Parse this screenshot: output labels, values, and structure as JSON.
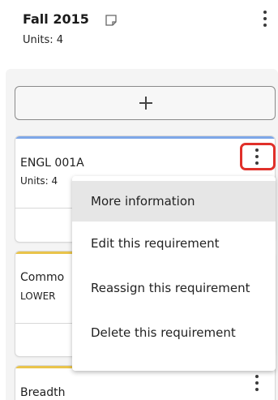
{
  "term": {
    "title": "Fall 2015",
    "units_text": "Units:  4"
  },
  "cards": [
    {
      "title": "ENGL 001A",
      "sub": "Units: 4",
      "accent": "#7ea7e8"
    },
    {
      "title": "Commo",
      "sub": "LOWER",
      "accent": "#e9c44b"
    },
    {
      "title": "Breadth",
      "accent": "#e9c44b"
    }
  ],
  "menu": {
    "items": [
      "More information",
      "Edit this requirement",
      "Reassign this requirement",
      "Delete this requirement"
    ]
  },
  "colors": {
    "highlight": "#e0302a",
    "blue_accent": "#7ea7e8",
    "yellow_accent": "#e9c44b"
  }
}
